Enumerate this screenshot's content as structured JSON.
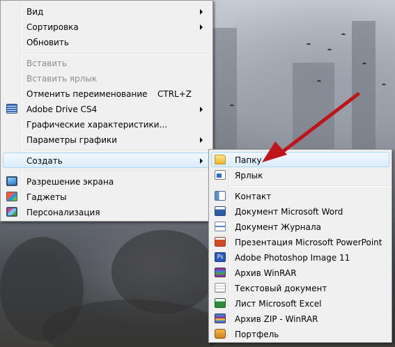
{
  "colors": {
    "menu_bg": "#f0f0f0",
    "highlight_border": "#a8d8f8",
    "disabled_text": "#8d8d8d",
    "annotation_arrow": "#c0141b"
  },
  "context_menu": {
    "items": [
      {
        "label": "Вид"
      },
      {
        "label": "Сортировка"
      },
      {
        "label": "Обновить"
      },
      {
        "label": "Вставить"
      },
      {
        "label": "Вставить ярлык"
      },
      {
        "label": "Отменить переименование",
        "shortcut": "CTRL+Z"
      },
      {
        "label": "Adobe Drive CS4",
        "icon": "adobe-drive-icon"
      },
      {
        "label": "Графические характеристики..."
      },
      {
        "label": "Параметры графики"
      },
      {
        "label": "Создать"
      },
      {
        "label": "Разрешение экрана",
        "icon": "screen-resolution-icon"
      },
      {
        "label": "Гаджеты",
        "icon": "gadgets-icon"
      },
      {
        "label": "Персонализация",
        "icon": "personalization-icon"
      }
    ]
  },
  "create_submenu": {
    "items": [
      {
        "label": "Папку",
        "icon": "folder-icon"
      },
      {
        "label": "Ярлык",
        "icon": "shortcut-icon"
      },
      {
        "label": "Контакт",
        "icon": "contact-icon"
      },
      {
        "label": "Документ Microsoft Word",
        "icon": "word-document-icon"
      },
      {
        "label": "Документ Журнала",
        "icon": "journal-document-icon"
      },
      {
        "label": "Презентация Microsoft PowerPoint",
        "icon": "powerpoint-icon"
      },
      {
        "label": "Adobe Photoshop Image 11",
        "icon": "photoshop-icon",
        "icon_text": "Ps"
      },
      {
        "label": "Архив WinRAR",
        "icon": "winrar-archive-icon"
      },
      {
        "label": "Текстовый документ",
        "icon": "text-document-icon"
      },
      {
        "label": "Лист Microsoft Excel",
        "icon": "excel-icon"
      },
      {
        "label": "Архив ZIP - WinRAR",
        "icon": "zip-archive-icon"
      },
      {
        "label": "Портфель",
        "icon": "briefcase-icon"
      }
    ]
  }
}
